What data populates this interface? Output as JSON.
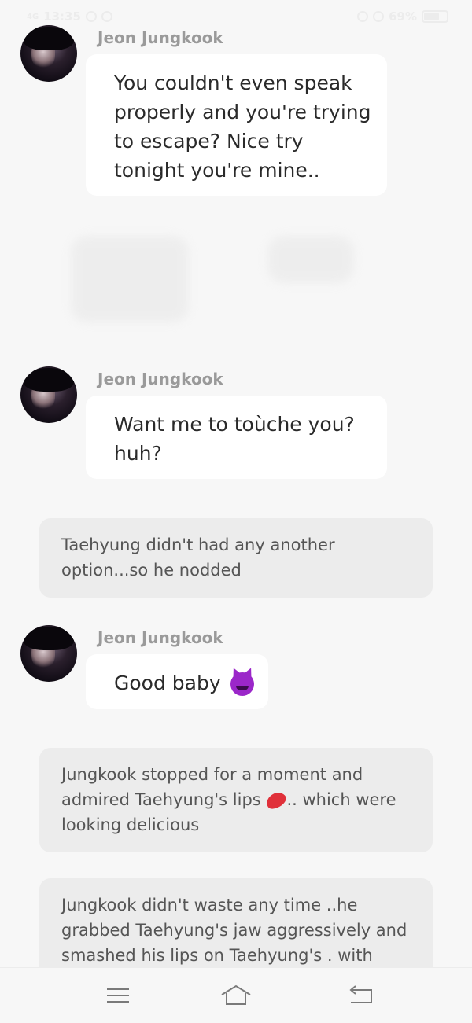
{
  "status_bar": {
    "time": "13:35",
    "network": "4G",
    "battery_percent": "69%",
    "battery_level": 0.69
  },
  "messages": [
    {
      "type": "chat",
      "sender": "Jeon Jungkook",
      "lines": [
        "You couldn't even speak",
        "properly and you're trying",
        "to escape? Nice try",
        "tonight you're mine.."
      ]
    },
    {
      "type": "chat",
      "sender": "Jeon Jungkook",
      "lines": [
        "Want me to toùche you?",
        "huh?"
      ]
    },
    {
      "type": "narration",
      "lines": [
        "Taehyung didn't had any another",
        "option...so he nodded"
      ]
    },
    {
      "type": "chat",
      "sender": "Jeon Jungkook",
      "lines": [
        "Good baby"
      ],
      "emoji": "smiling-devil-emoji"
    },
    {
      "type": "narration",
      "lines": [
        "Jungkook stopped for a moment and",
        "admired Taehyung's lips",
        ".. which were",
        "looking delicious"
      ],
      "emoji": "kiss-mark-emoji"
    },
    {
      "type": "narration",
      "lines": [
        "Jungkook didn't waste any time ..he",
        "grabbed Taehyung's jaw aggressively and",
        "smashed his lips on Taehyung's . with"
      ]
    }
  ],
  "nav_bar": {
    "icons": [
      "menu-icon",
      "home-icon",
      "back-icon"
    ]
  }
}
